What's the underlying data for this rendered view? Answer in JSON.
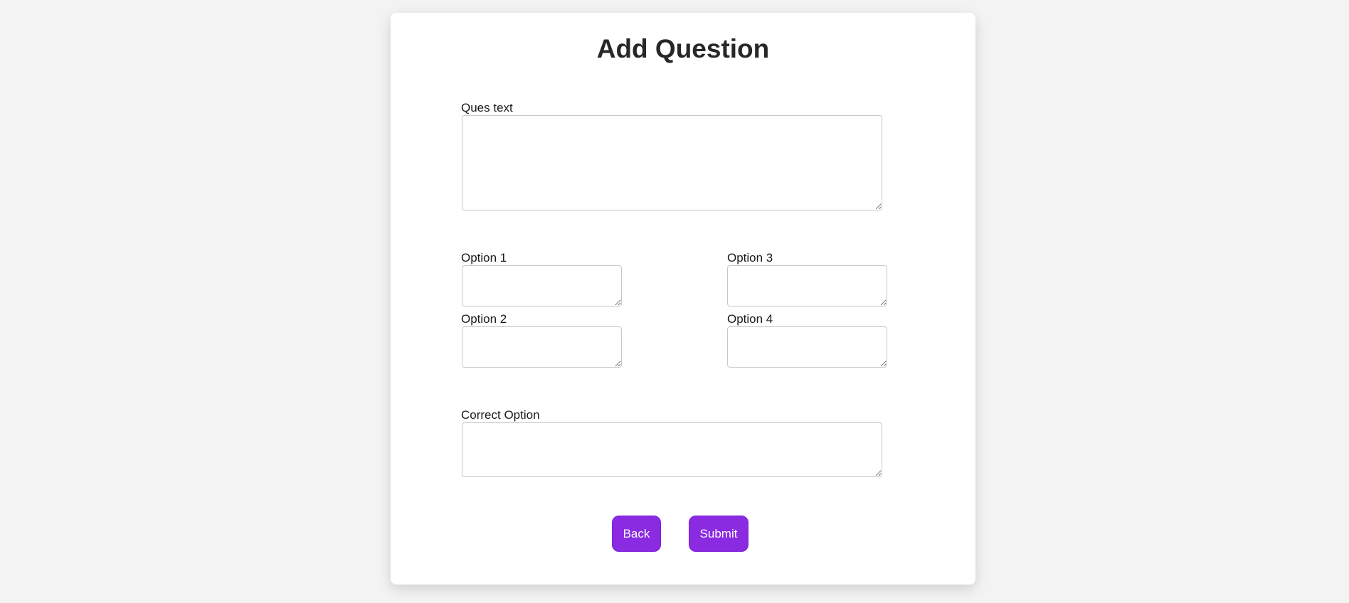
{
  "page": {
    "title": "Add Question"
  },
  "form": {
    "question": {
      "label": "Ques text",
      "value": ""
    },
    "option1": {
      "label": "Option 1",
      "value": ""
    },
    "option2": {
      "label": "Option 2",
      "value": ""
    },
    "option3": {
      "label": "Option 3",
      "value": ""
    },
    "option4": {
      "label": "Option 4",
      "value": ""
    },
    "correct": {
      "label": "Correct Option",
      "value": ""
    }
  },
  "buttons": {
    "back": "Back",
    "submit": "Submit"
  },
  "colors": {
    "accent": "#8a2be2",
    "background": "#f3f3f3",
    "card": "#ffffff"
  }
}
